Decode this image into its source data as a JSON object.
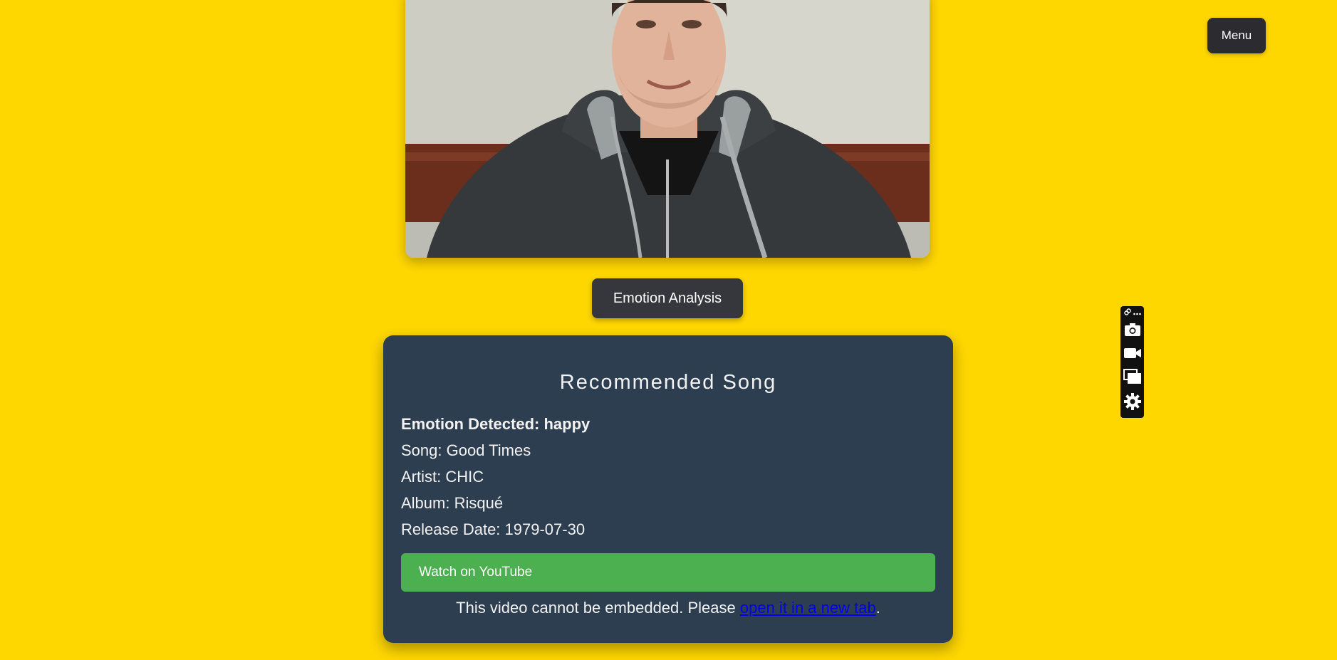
{
  "header": {
    "menu_label": "Menu"
  },
  "webcam": {
    "description_icon": "webcam-feed"
  },
  "actions": {
    "emotion_analysis_label": "Emotion Analysis"
  },
  "recommendation": {
    "title": "Recommended Song",
    "emotion_line": "Emotion Detected: happy",
    "song_line": "Song: Good Times",
    "artist_line": "Artist: CHIC",
    "album_line": "Album: Risqué",
    "release_line": "Release Date: 1979-07-30",
    "youtube_label": "Watch on YouTube",
    "embed_note_prefix": "This video cannot be embedded. Please ",
    "embed_note_link": "open it in a new tab",
    "embed_note_suffix": "."
  },
  "toolbar": {
    "icons": [
      "link-icon",
      "more-icon",
      "camera-icon",
      "video-icon",
      "screens-icon",
      "settings-icon"
    ]
  },
  "colors": {
    "background": "#FFD700",
    "card": "#2d3e50",
    "button_dark": "#2b2b30",
    "youtube_green": "#4caf50",
    "link": "#0000ee"
  }
}
